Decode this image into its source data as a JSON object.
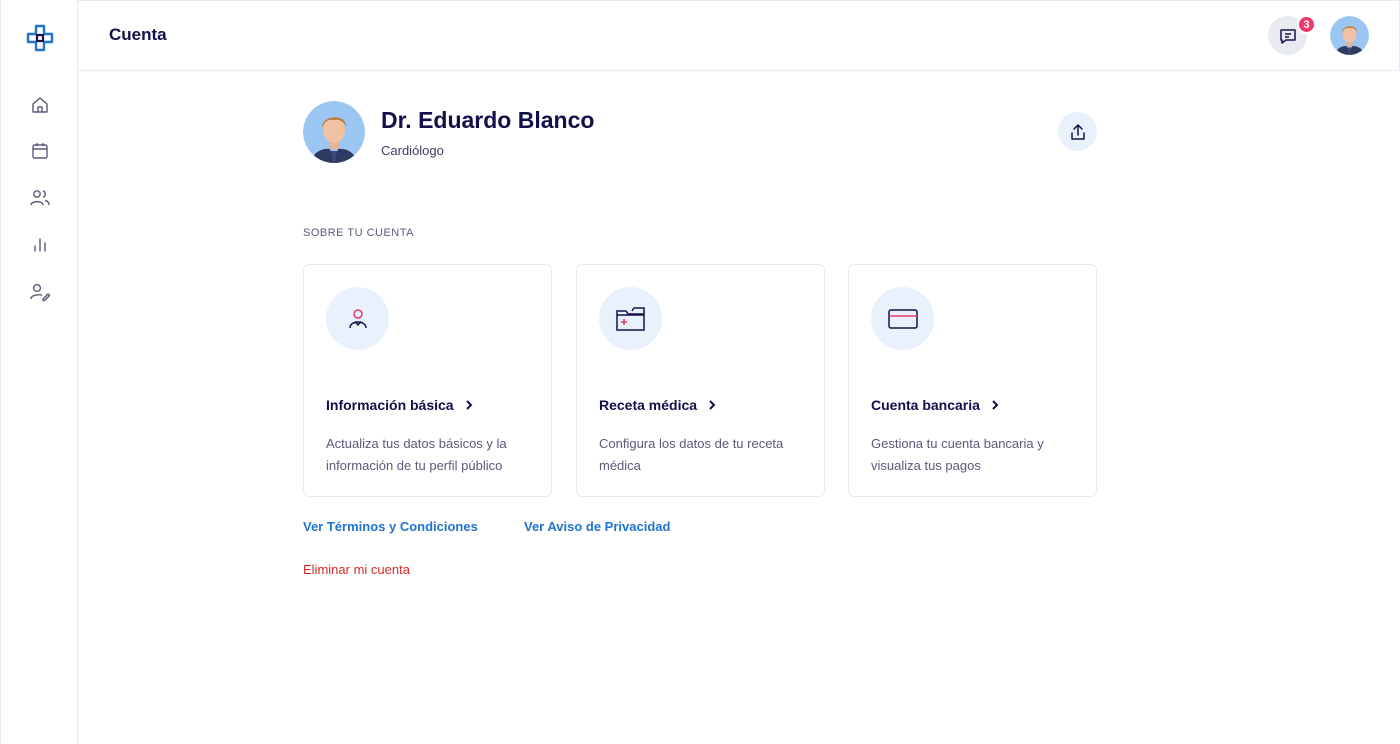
{
  "header": {
    "title": "Cuenta",
    "notification_count": "3"
  },
  "profile": {
    "name": "Dr. Eduardo Blanco",
    "role": "Cardiólogo"
  },
  "section": {
    "label": "SOBRE TU CUENTA"
  },
  "cards": [
    {
      "title": "Información básica",
      "description": "Actualiza tus datos básicos y la información de tu perfil público",
      "icon": "user-icon"
    },
    {
      "title": "Receta médica",
      "description": "Configura los datos de tu receta médica",
      "icon": "folder-plus-icon"
    },
    {
      "title": "Cuenta bancaria",
      "description": "Gestiona tu cuenta bancaria y visualiza tus pagos",
      "icon": "credit-card-icon"
    }
  ],
  "links": {
    "terms": "Ver Términos y Condiciones",
    "privacy": "Ver Aviso de Privacidad",
    "delete": "Eliminar mi cuenta"
  },
  "colors": {
    "brand": "#2075d0",
    "accent_pink": "#f0386b",
    "danger": "#d42a2a",
    "icon_bg": "#e9f1fc"
  },
  "sidebar": {
    "icons": [
      "home-icon",
      "calendar-icon",
      "users-icon",
      "chart-icon",
      "user-edit-icon"
    ]
  }
}
